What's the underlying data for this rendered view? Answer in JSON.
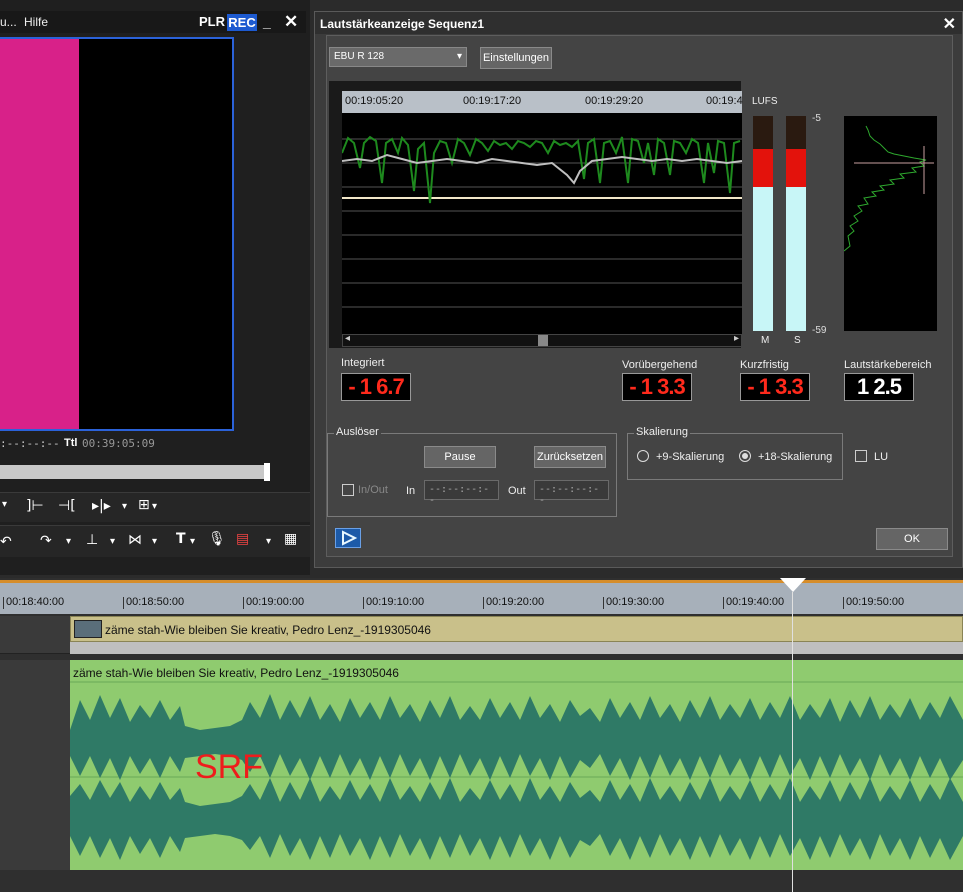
{
  "player": {
    "menu_partial": "u...",
    "menu_help": "Hilfe",
    "plr": "PLR",
    "rec": "REC",
    "minimize": "_",
    "close": "✕",
    "tc_in": ":--:--:--",
    "ttl": "Ttl",
    "tc_total": "00:39:05:09",
    "video_colors": {
      "left": "#d82189",
      "right": "#000000",
      "frame": "#2b62d9"
    }
  },
  "dialog": {
    "title": "Lautstärkeanzeige  Sequenz1",
    "close": "✕",
    "standard_select": "EBU R 128",
    "settings_button": "Einstellungen",
    "ruler_labels": [
      "00:19:05:20",
      "00:19:17:20",
      "00:19:29:20",
      "00:19:4"
    ],
    "lufs_label": "LUFS",
    "scale_top": "-5",
    "scale_bottom": "-59",
    "meter_m_label": "M",
    "meter_s_label": "S",
    "integrated_label": "Integriert",
    "integrated_value": "- 1 6.7",
    "momentary_label": "Vorübergehend",
    "momentary_value": "- 1 3.3",
    "short_term_label": "Kurzfristig",
    "short_term_value": "- 1 3.3",
    "range_label": "Lautstärkebereich",
    "range_value": "1 2.5",
    "trigger_group": "Auslöser",
    "pause_button": "Pause",
    "reset_button": "Zurücksetzen",
    "inout_label": "In/Out",
    "in_label": "In",
    "in_value": "--:--:--:--",
    "out_label": "Out",
    "out_value": "--:--:--:--",
    "scaling_group": "Skalierung",
    "scale9_label": "+9-Skalierung",
    "scale18_label": "+18-Skalierung",
    "scale_selected": "+18-Skalierung",
    "lu_label": "LU",
    "ok_button": "OK",
    "meter_colors": {
      "red": "#e3120c",
      "cyan": "#c8f6f7"
    }
  },
  "timeline": {
    "ticks": [
      "00:18:40:00",
      "00:18:50:00",
      "00:19:00:00",
      "00:19:10:00",
      "00:19:20:00",
      "00:19:30:00",
      "00:19:40:00",
      "00:19:50:00"
    ],
    "video_clip_name": "zäme stah-Wie bleiben Sie kreativ, Pedro Lenz_-1919305046",
    "audio_clip_name": "zäme stah-Wie bleiben Sie kreativ, Pedro Lenz_-1919305046",
    "overlay_text": "SRF",
    "audio_color": "#8fcb6f",
    "video_clip_color": "#c9c08a"
  }
}
